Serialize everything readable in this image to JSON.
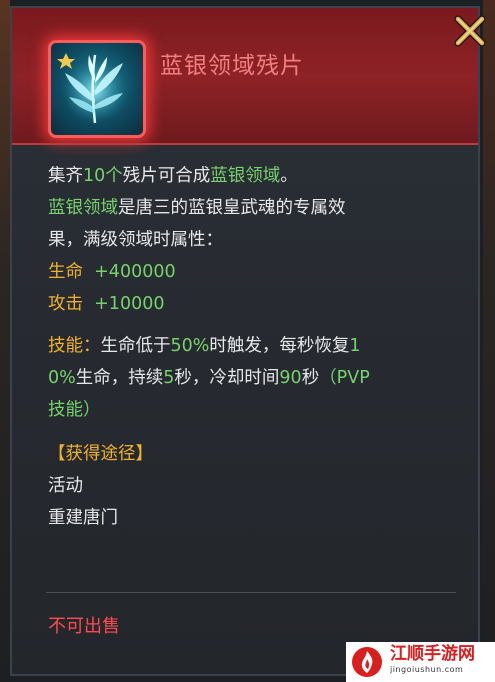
{
  "item": {
    "title": "蓝银领域残片",
    "icon": "bluesilver-grass-icon",
    "description": {
      "line1": {
        "pre": "集齐",
        "num": "10个",
        "mid": "残片可合成",
        "highlight": "蓝银领域",
        "post": "。"
      },
      "line2": {
        "highlight": "蓝银领域",
        "rest": "是唐三的蓝银皇武魂的专属效"
      },
      "line3": "果，满级领域时属性："
    },
    "stats": [
      {
        "label": "生命",
        "value": "+400000"
      },
      {
        "label": "攻击",
        "value": "+10000"
      }
    ],
    "skill": {
      "label": "技能：",
      "line1": {
        "a": "生命低于",
        "b": "50%",
        "c": "时触发，每秒恢复",
        "d": "1"
      },
      "line2": {
        "a": "0%",
        "b": "生命，持续",
        "c": "5",
        "d": "秒，冷却时间",
        "e": "90",
        "f": "秒",
        "g": "（PVP"
      },
      "line3": "技能）"
    },
    "source": {
      "header": "【获得途径】",
      "items": [
        "活动",
        "重建唐门"
      ]
    },
    "sell_status": "不可出售"
  },
  "watermark": {
    "cn": "江顺手游网",
    "en": "jingoiushun.com"
  },
  "colors": {
    "accent_red": "#ff4b4b",
    "green": "#76d36b",
    "gold": "#f0b22a",
    "header_red": "#8e2226"
  }
}
